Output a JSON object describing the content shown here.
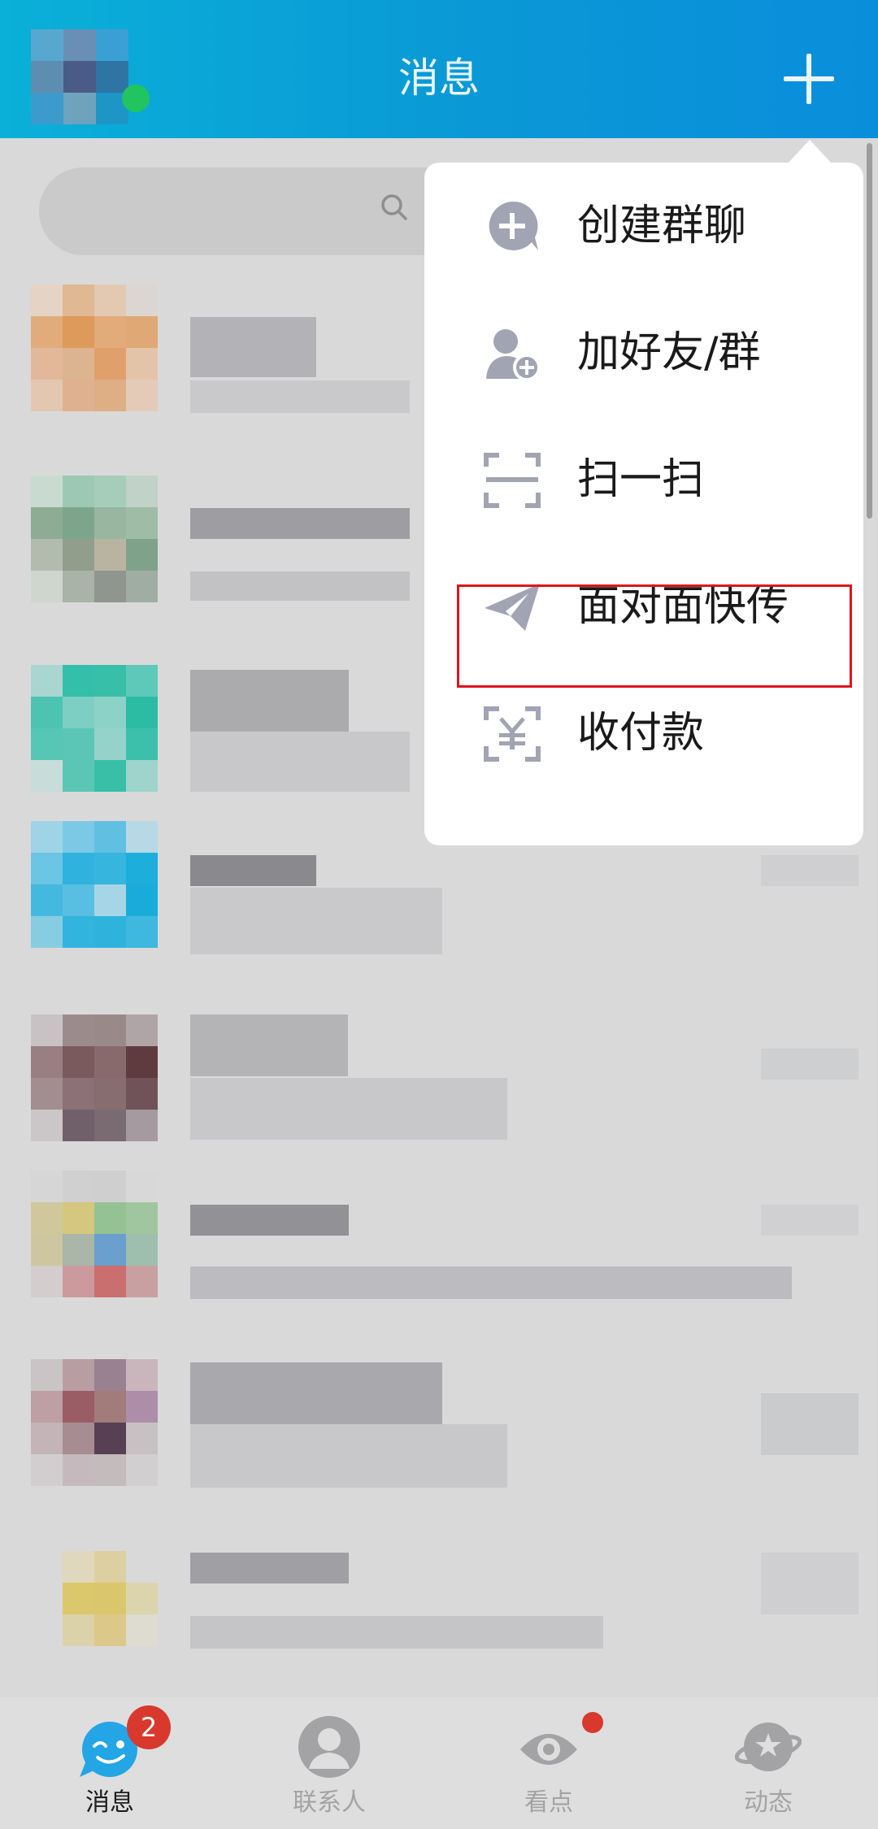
{
  "header": {
    "title": "消息"
  },
  "popup_menu": {
    "items": [
      {
        "label": "创建群聊",
        "icon": "create-group-chat-icon"
      },
      {
        "label": "加好友/群",
        "icon": "add-friend-icon"
      },
      {
        "label": "扫一扫",
        "icon": "scan-icon"
      },
      {
        "label": "面对面快传",
        "icon": "paper-plane-icon",
        "highlighted": true
      },
      {
        "label": "收付款",
        "icon": "payment-icon"
      }
    ]
  },
  "tabbar": {
    "tabs": [
      {
        "label": "消息",
        "badge": "2",
        "active": true
      },
      {
        "label": "联系人"
      },
      {
        "label": "看点",
        "dot": true
      },
      {
        "label": "动态"
      }
    ]
  },
  "colors": {
    "header_gradient_start": "#0ab0d8",
    "header_gradient_end": "#0a8edb",
    "highlight_border": "#e0141b",
    "badge_red": "#d9382c",
    "icon_gray": "#a1a4b3"
  }
}
